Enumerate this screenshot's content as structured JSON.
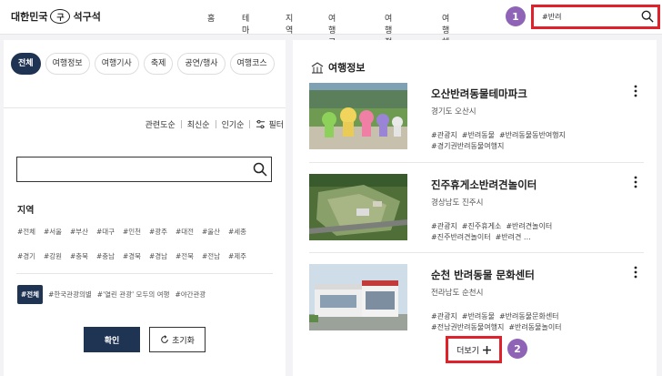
{
  "header": {
    "logo_text": "대한민국",
    "logo_mark": "구",
    "logo_sub": "석구석",
    "nav": [
      "홈",
      "테마",
      "지역",
      "여행코스",
      "여행정보",
      "여행혜택"
    ],
    "search_value": "#반려"
  },
  "badges": {
    "one": "1",
    "two": "2"
  },
  "left": {
    "tabs": [
      "전체",
      "여행정보",
      "여행기사",
      "축제",
      "공연/행사",
      "여행코스"
    ],
    "sort": [
      "관련도순",
      "최신순",
      "인기순",
      "필터"
    ],
    "region_title": "지역",
    "regions_row1": [
      "#전체",
      "#서울",
      "#부산",
      "#대구",
      "#인천",
      "#광주",
      "#대전",
      "#울산",
      "#세종"
    ],
    "regions_row2": [
      "#경기",
      "#강원",
      "#충북",
      "#충남",
      "#경북",
      "#경남",
      "#전북",
      "#전남",
      "#제주"
    ],
    "themes": [
      "#전체",
      "#한국관광의별",
      "#'열린 관광' 모두의 여행",
      "#야간관광"
    ],
    "confirm": "확인",
    "reset": "초기화"
  },
  "right": {
    "section_title": "여행정보",
    "items": [
      {
        "title": "오산반려동물테마파크",
        "location": "경기도 오산시",
        "tags_line1": [
          "#관광지",
          "#반려동물",
          "#반려동물동반여행지"
        ],
        "tags_line2": [
          "#경기권반려동물여행지"
        ]
      },
      {
        "title": "진주휴게소반려견놀이터",
        "location": "경상남도 진주시",
        "tags_line1": [
          "#관광지",
          "#진주휴게소",
          "#반려견놀이터"
        ],
        "tags_line2": [
          "#진주반려견놀이터",
          "#반려견 …"
        ]
      },
      {
        "title": "순천 반려동물 문화센터",
        "location": "전라남도 순천시",
        "tags_line1": [
          "#관광지",
          "#반려동물",
          "#반려동물문화센터"
        ],
        "tags_line2": [
          "#전남권반려동물여행지",
          "#반려동물놀이터"
        ]
      }
    ],
    "more_label": "더보기"
  },
  "colors": {
    "accent": "#e0202a",
    "navy": "#1f3353",
    "badge": "#8f63b5"
  }
}
